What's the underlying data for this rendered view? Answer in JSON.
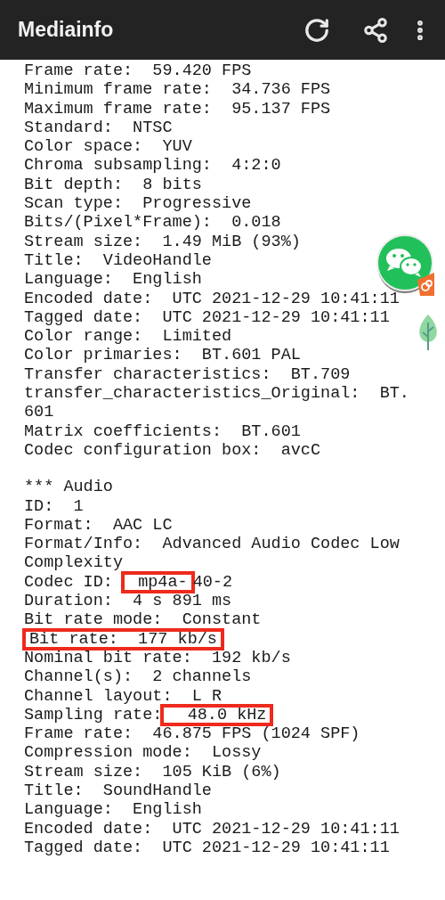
{
  "app_bar": {
    "title": "Mediainfo"
  },
  "sections": [
    {
      "lines": [
        {
          "parts": [
            {
              "text": "Frame rate:  59.420 FPS",
              "marked": false
            }
          ]
        },
        {
          "parts": [
            {
              "text": "Minimum frame rate:  34.736 FPS",
              "marked": false
            }
          ]
        },
        {
          "parts": [
            {
              "text": "Maximum frame rate:  95.137 FPS",
              "marked": false
            }
          ]
        },
        {
          "parts": [
            {
              "text": "Standard:  NTSC",
              "marked": false
            }
          ]
        },
        {
          "parts": [
            {
              "text": "Color space:  YUV",
              "marked": false
            }
          ]
        },
        {
          "parts": [
            {
              "text": "Chroma subsampling:  4:2:0",
              "marked": false
            }
          ]
        },
        {
          "parts": [
            {
              "text": "Bit depth:  8 bits",
              "marked": false
            }
          ]
        },
        {
          "parts": [
            {
              "text": "Scan type:  Progressive",
              "marked": false
            }
          ]
        },
        {
          "parts": [
            {
              "text": "Bits/(Pixel*Frame):  0.018",
              "marked": false
            }
          ]
        },
        {
          "parts": [
            {
              "text": "Stream size:  1.49 MiB (93%)",
              "marked": false
            }
          ]
        },
        {
          "parts": [
            {
              "text": "Title:  VideoHandle",
              "marked": false
            }
          ]
        },
        {
          "parts": [
            {
              "text": "Language:  English",
              "marked": false
            }
          ]
        },
        {
          "parts": [
            {
              "text": "Encoded date:  UTC 2021-12-29 10:41:11",
              "marked": false
            }
          ]
        },
        {
          "parts": [
            {
              "text": "Tagged date:  UTC 2021-12-29 10:41:11",
              "marked": false
            }
          ]
        },
        {
          "parts": [
            {
              "text": "Color range:  Limited",
              "marked": false
            }
          ]
        },
        {
          "parts": [
            {
              "text": "Color primaries:  BT.601 PAL",
              "marked": false
            }
          ]
        },
        {
          "parts": [
            {
              "text": "Transfer characteristics:  BT.709",
              "marked": false
            }
          ]
        },
        {
          "parts": [
            {
              "text": "transfer_characteristics_Original:  BT.",
              "marked": false
            }
          ]
        },
        {
          "parts": [
            {
              "text": "601",
              "marked": false
            }
          ]
        },
        {
          "parts": [
            {
              "text": "Matrix coefficients:  BT.601",
              "marked": false
            }
          ]
        },
        {
          "parts": [
            {
              "text": "Codec configuration box:  avcC",
              "marked": false
            }
          ]
        }
      ]
    },
    {
      "lines": [
        {
          "parts": [
            {
              "text": "*** Audio",
              "marked": false
            }
          ]
        },
        {
          "parts": [
            {
              "text": "ID:  1",
              "marked": false
            }
          ]
        },
        {
          "parts": [
            {
              "text": "Format:  AAC LC",
              "marked": false
            }
          ]
        },
        {
          "parts": [
            {
              "text": "Format/Info:  Advanced Audio Codec Low",
              "marked": false
            }
          ]
        },
        {
          "parts": [
            {
              "text": "Complexity",
              "marked": false
            }
          ]
        },
        {
          "parts": [
            {
              "text": "Codec ID: ",
              "marked": false
            },
            {
              "text": " mp4a-",
              "marked": true
            },
            {
              "text": "40-2",
              "marked": false
            }
          ]
        },
        {
          "parts": [
            {
              "text": "Duration:  4 s 891 ms",
              "marked": false
            }
          ]
        },
        {
          "parts": [
            {
              "text": "Bit rate mode:  Constant",
              "marked": false
            }
          ]
        },
        {
          "parts": [
            {
              "text": "Bit rate:  177 kb/s",
              "marked": true
            }
          ]
        },
        {
          "parts": [
            {
              "text": "Nominal bit rate:  192 kb/s",
              "marked": false
            }
          ]
        },
        {
          "parts": [
            {
              "text": "Channel(s):  2 channels",
              "marked": false
            }
          ]
        },
        {
          "parts": [
            {
              "text": "Channel layout:  L R",
              "marked": false
            }
          ]
        },
        {
          "parts": [
            {
              "text": "Sampling rate:",
              "marked": false
            },
            {
              "text": "  48.0 kHz",
              "marked": true
            }
          ]
        },
        {
          "parts": [
            {
              "text": "Frame rate:  46.875 FPS (1024 SPF)",
              "marked": false
            }
          ]
        },
        {
          "parts": [
            {
              "text": "Compression mode:  Lossy",
              "marked": false
            }
          ]
        },
        {
          "parts": [
            {
              "text": "Stream size:  105 KiB (6%)",
              "marked": false
            }
          ]
        },
        {
          "parts": [
            {
              "text": "Title:  SoundHandle",
              "marked": false
            }
          ]
        },
        {
          "parts": [
            {
              "text": "Language:  English",
              "marked": false
            }
          ]
        },
        {
          "parts": [
            {
              "text": "Encoded date:  UTC 2021-12-29 10:41:11",
              "marked": false
            }
          ]
        },
        {
          "parts": [
            {
              "text": "Tagged date:  UTC 2021-12-29 10:41:11",
              "marked": false
            }
          ]
        }
      ]
    }
  ]
}
